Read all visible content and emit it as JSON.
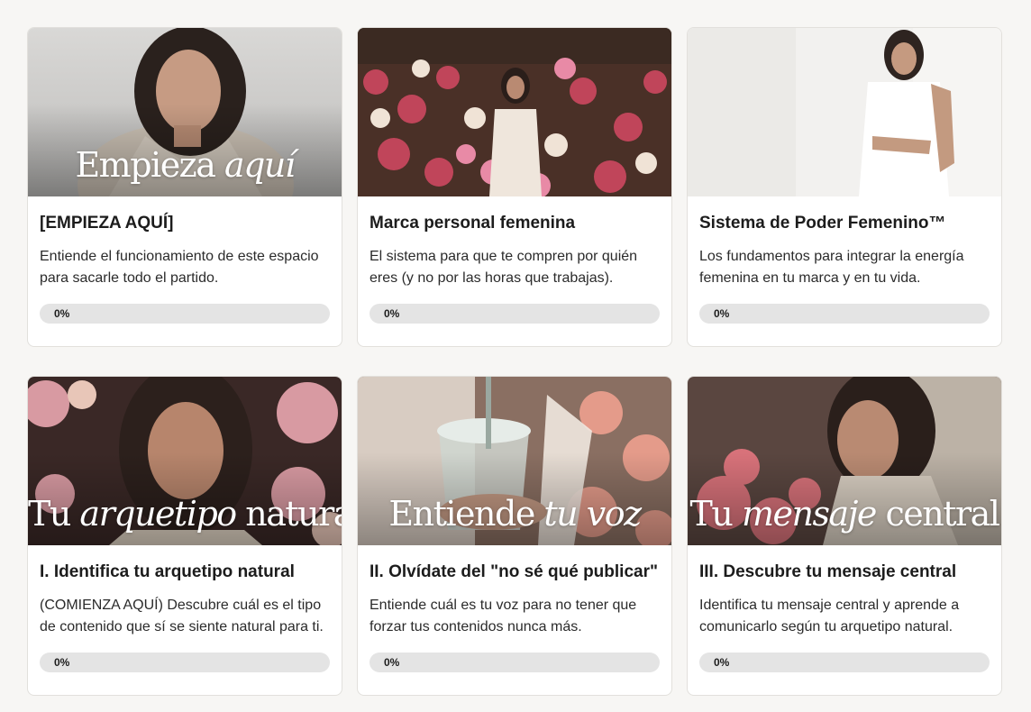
{
  "courses": [
    {
      "image_title": {
        "regular": "Empieza",
        "italic": "aquí",
        "regular_after": ""
      },
      "title": "[EMPIEZA AQUÍ]",
      "description": "Entiende el funcionamiento de este espacio para sacarle todo el partido.",
      "progress": 0,
      "progress_label": "0%",
      "scene": {
        "bg_top": "#d9d8d6",
        "bg_bottom": "#bdbcba",
        "accent": "#e6dfd6"
      }
    },
    {
      "image_title": {
        "regular": "",
        "italic": "",
        "regular_after": ""
      },
      "title": "Marca personal femenina",
      "description": "El sistema para que te compren por quién eres (y no por las horas que trabajas).",
      "progress": 0,
      "progress_label": "0%",
      "scene": {
        "bg_top": "#5a3a2f",
        "bg_bottom": "#b2525e",
        "accent": "#efe6dc"
      }
    },
    {
      "image_title": {
        "regular": "",
        "italic": "",
        "regular_after": ""
      },
      "title": "Sistema de Poder Femenino™",
      "description": "Los fundamentos para integrar la energía femenina en tu marca y en tu vida.",
      "progress": 0,
      "progress_label": "0%",
      "scene": {
        "bg_top": "#f4f3f1",
        "bg_bottom": "#e7e5e2",
        "accent": "#ffffff"
      }
    },
    {
      "image_title": {
        "regular": "Tu",
        "italic": "arquetipo",
        "regular_after": "natural"
      },
      "title": "I. Identifica tu arquetipo natural",
      "description": "(COMIENZA AQUÍ) Descubre cuál es el tipo de contenido que sí se siente natural para ti.",
      "progress": 0,
      "progress_label": "0%",
      "scene": {
        "bg_top": "#3b2a28",
        "bg_bottom": "#6e4a48",
        "accent": "#d99aa4"
      }
    },
    {
      "image_title": {
        "regular": "Entiende",
        "italic": "tu voz",
        "regular_after": ""
      },
      "title": "II. Olvídate del \"no sé qué publicar\"",
      "description": "Entiende cuál es tu voz para no tener que forzar tus contenidos nunca más.",
      "progress": 0,
      "progress_label": "0%",
      "scene": {
        "bg_top": "#b89a88",
        "bg_bottom": "#6e5648",
        "accent": "#e6a08e"
      }
    },
    {
      "image_title": {
        "regular": "Tu",
        "italic": "mensaje",
        "regular_after": "central"
      },
      "title": "III. Descubre tu mensaje central",
      "description": "Identifica tu mensaje central y aprende a comunicarlo según tu arquetipo natural.",
      "progress": 0,
      "progress_label": "0%",
      "scene": {
        "bg_top": "#8a7a6e",
        "bg_bottom": "#4a3530",
        "accent": "#d8727a"
      }
    }
  ]
}
